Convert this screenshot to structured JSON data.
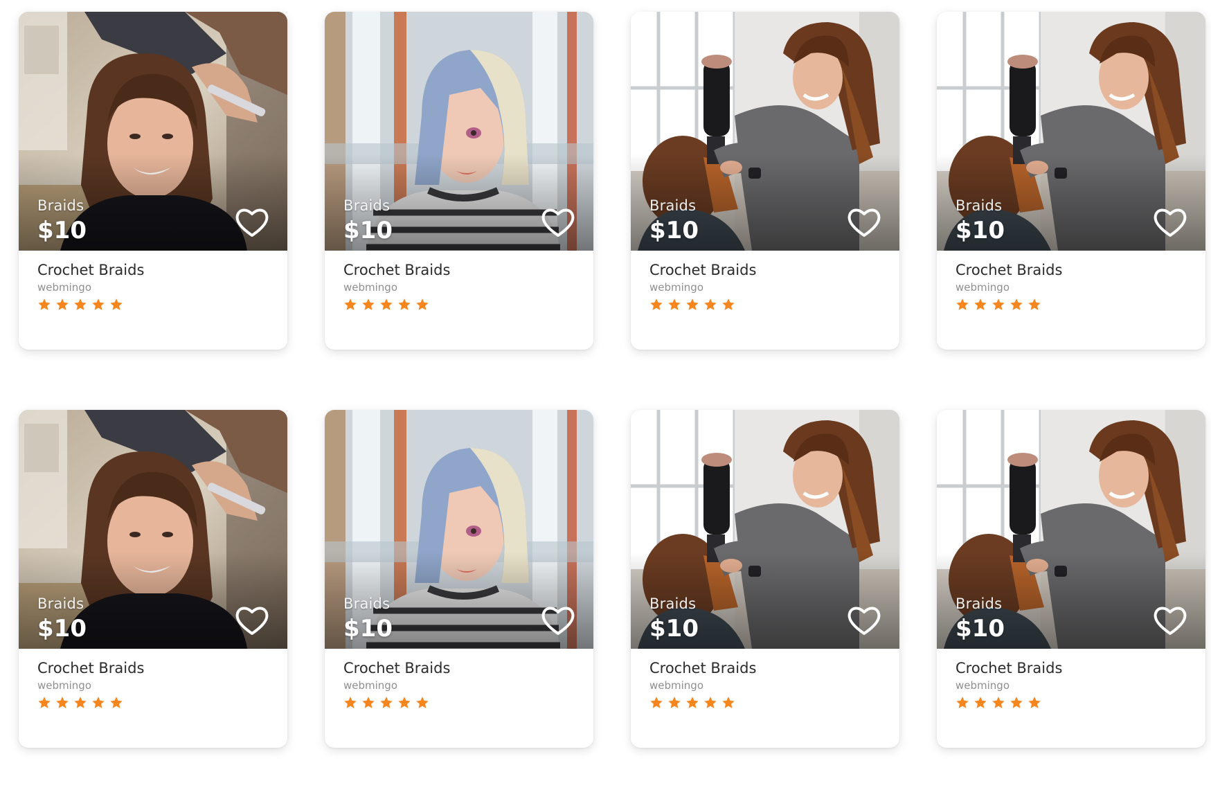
{
  "accent_color": "#f7861e",
  "cards": [
    {
      "photo": "salon-haircut-photo",
      "category": "Braids",
      "price": "$10",
      "title": "Crochet Braids",
      "vendor": "webmingo",
      "rating": 5
    },
    {
      "photo": "blue-bob-wig-photo",
      "category": "Braids",
      "price": "$10",
      "title": "Crochet Braids",
      "vendor": "webmingo",
      "rating": 5
    },
    {
      "photo": "blow-dry-photo",
      "category": "Braids",
      "price": "$10",
      "title": "Crochet Braids",
      "vendor": "webmingo",
      "rating": 5
    },
    {
      "photo": "blow-dry-photo",
      "category": "Braids",
      "price": "$10",
      "title": "Crochet Braids",
      "vendor": "webmingo",
      "rating": 5
    },
    {
      "photo": "salon-haircut-photo",
      "category": "Braids",
      "price": "$10",
      "title": "Crochet Braids",
      "vendor": "webmingo",
      "rating": 5
    },
    {
      "photo": "blue-bob-wig-photo",
      "category": "Braids",
      "price": "$10",
      "title": "Crochet Braids",
      "vendor": "webmingo",
      "rating": 5
    },
    {
      "photo": "blow-dry-photo",
      "category": "Braids",
      "price": "$10",
      "title": "Crochet Braids",
      "vendor": "webmingo",
      "rating": 5
    },
    {
      "photo": "blow-dry-photo",
      "category": "Braids",
      "price": "$10",
      "title": "Crochet Braids",
      "vendor": "webmingo",
      "rating": 5
    }
  ],
  "icons": {
    "favorite": "heart-outline-icon",
    "rating": "star-icon"
  }
}
